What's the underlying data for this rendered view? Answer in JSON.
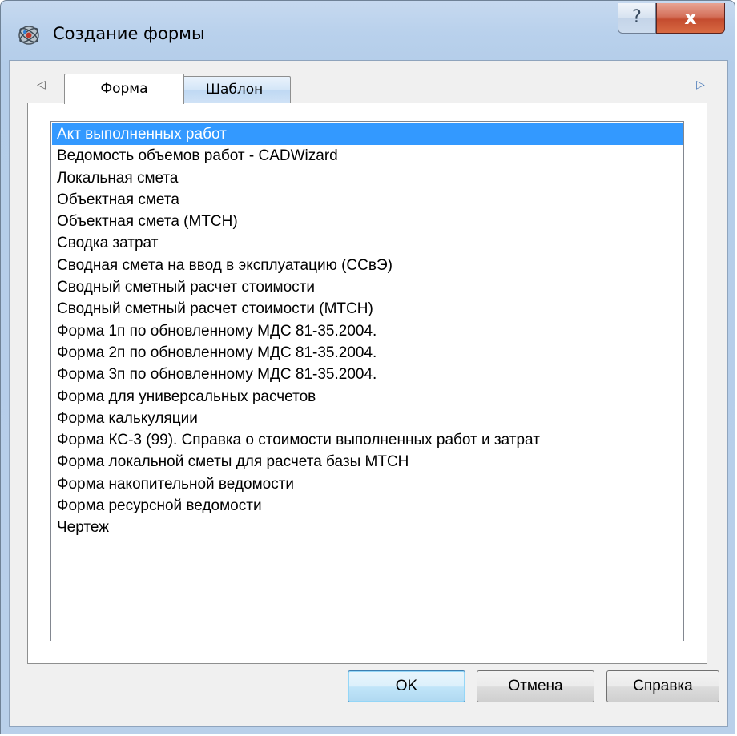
{
  "window": {
    "title": "Создание формы",
    "help_glyph": "?",
    "close_glyph": "x"
  },
  "tabs": {
    "scroll_left": "◁",
    "scroll_right": "▷",
    "items": [
      {
        "label": "Форма",
        "active": true
      },
      {
        "label": "Шаблон",
        "active": false
      }
    ]
  },
  "list": {
    "selected_index": 0,
    "items": [
      "Акт выполненных работ",
      "Ведомость объемов работ - CADWizard",
      "Локальная смета",
      "Объектная смета",
      "Объектная смета (МТСН)",
      "Сводка затрат",
      "Сводная смета на ввод в эксплуатацию (ССвЭ)",
      "Сводный сметный расчет стоимости",
      "Сводный сметный расчет стоимости (МТСН)",
      "Форма 1п по обновленному МДС 81-35.2004.",
      "Форма 2п по обновленному МДС 81-35.2004.",
      "Форма 3п по обновленному МДС 81-35.2004.",
      "Форма для универсальных расчетов",
      "Форма калькуляции",
      "Форма КС-3 (99). Справка о стоимости выполненных работ и затрат",
      "Форма локальной сметы для расчета базы МТСН",
      "Форма накопительной ведомости",
      "Форма ресурсной ведомости",
      "Чертеж"
    ]
  },
  "buttons": {
    "ok": "OK",
    "cancel": "Отмена",
    "help": "Справка"
  },
  "colors": {
    "selection": "#3399ff",
    "close_button": "#c44c2f",
    "title_bar": "#b9d1ec"
  }
}
